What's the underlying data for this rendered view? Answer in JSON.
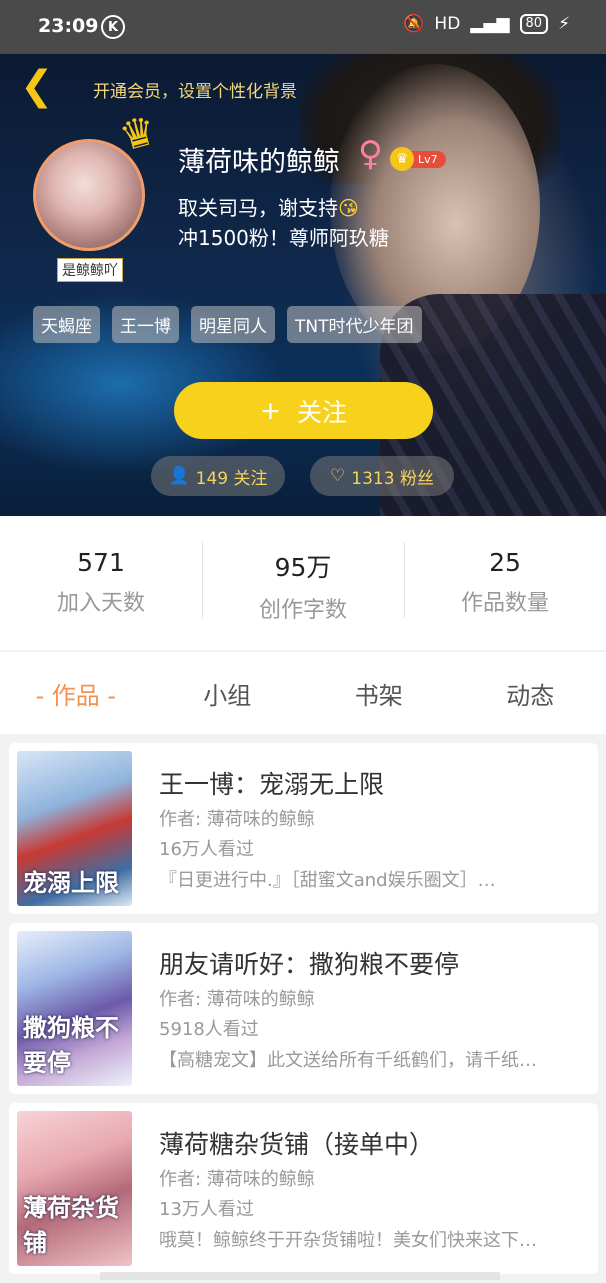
{
  "status_bar": {
    "time": "23:09",
    "network": "HD",
    "signal": "4G",
    "battery": "80"
  },
  "header": {
    "vip_link": "开通会员，设置个性化背景",
    "avatar_caption": "是鲸鲸吖",
    "username": "薄荷味的鲸鲸",
    "gender_symbol": "♀",
    "level": "Lv7",
    "bio_line1": "取关司马，谢支持",
    "bio_line2": "冲1500粉！尊师阿玖糖",
    "tags": [
      "天蝎座",
      "王一博",
      "明星同人",
      "TNT时代少年团"
    ],
    "follow_button": "关注",
    "following_count": "149 关注",
    "fans_count": "1313 粉丝"
  },
  "stats": [
    {
      "value": "571",
      "label": "加入天数"
    },
    {
      "value": "95万",
      "label": "创作字数"
    },
    {
      "value": "25",
      "label": "作品数量"
    }
  ],
  "tabs": [
    "- 作品 -",
    "小组",
    "书架",
    "动态"
  ],
  "works": [
    {
      "title": "王一博：宠溺无上限",
      "author": "作者: 薄荷味的鲸鲸",
      "views": "16万人看过",
      "desc": "『日更进行中.』［甜蜜文and娱乐圈文］…",
      "cover_text": "宠溺上限"
    },
    {
      "title": "朋友请听好：撒狗粮不要停",
      "author": "作者: 薄荷味的鲸鲸",
      "views": "5918人看过",
      "desc": "【高糖宠文】此文送给所有千纸鹤们，请千纸…",
      "cover_text": "撒狗粮不要停"
    },
    {
      "title": "薄荷糖杂货铺（接单中）",
      "author": "作者: 薄荷味的鲸鲸",
      "views": "13万人看过",
      "desc": "哦莫！鲸鲸终于开杂货铺啦！美女们快来这下…",
      "cover_text": "薄荷杂货铺"
    }
  ]
}
